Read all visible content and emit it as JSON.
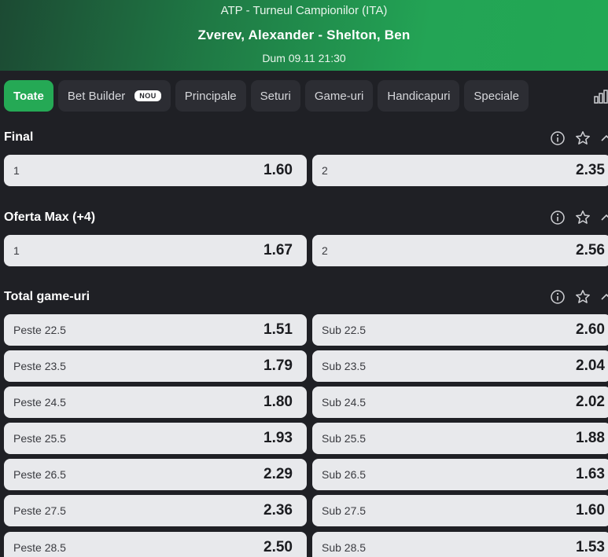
{
  "header": {
    "competition": "ATP - Turneul Campionilor (ITA)",
    "match": "Zverev, Alexander - Shelton, Ben",
    "date": "Dum 09.11 21:30"
  },
  "tabs": [
    {
      "label": "Toate",
      "active": true
    },
    {
      "label": "Bet Builder",
      "badge": "NOU"
    },
    {
      "label": "Principale"
    },
    {
      "label": "Seturi"
    },
    {
      "label": "Game-uri"
    },
    {
      "label": "Handicapuri"
    },
    {
      "label": "Speciale"
    }
  ],
  "sections": {
    "final": {
      "title": "Final",
      "left": {
        "label": "1",
        "odd": "1.60"
      },
      "right": {
        "label": "2",
        "odd": "2.35"
      }
    },
    "oferta": {
      "title": "Oferta Max (+4)",
      "left": {
        "label": "1",
        "odd": "1.67"
      },
      "right": {
        "label": "2",
        "odd": "2.56"
      }
    },
    "total": {
      "title": "Total game-uri",
      "rows": [
        {
          "over": "Peste 22.5",
          "over_odd": "1.51",
          "under": "Sub 22.5",
          "under_odd": "2.60"
        },
        {
          "over": "Peste 23.5",
          "over_odd": "1.79",
          "under": "Sub 23.5",
          "under_odd": "2.04"
        },
        {
          "over": "Peste 24.5",
          "over_odd": "1.80",
          "under": "Sub 24.5",
          "under_odd": "2.02"
        },
        {
          "over": "Peste 25.5",
          "over_odd": "1.93",
          "under": "Sub 25.5",
          "under_odd": "1.88"
        },
        {
          "over": "Peste 26.5",
          "over_odd": "2.29",
          "under": "Sub 26.5",
          "under_odd": "1.63"
        },
        {
          "over": "Peste 27.5",
          "over_odd": "2.36",
          "under": "Sub 27.5",
          "under_odd": "1.60"
        },
        {
          "over": "Peste 28.5",
          "over_odd": "2.50",
          "under": "Sub 28.5",
          "under_odd": "1.53"
        }
      ]
    }
  },
  "icons": {
    "info": "info-icon",
    "favorite": "star-icon",
    "collapse": "chevron-up-icon",
    "stats": "stats-icon"
  },
  "colors": {
    "accent": "#25a955",
    "background": "#1f2025",
    "odd_button": "#e8e9ec"
  }
}
